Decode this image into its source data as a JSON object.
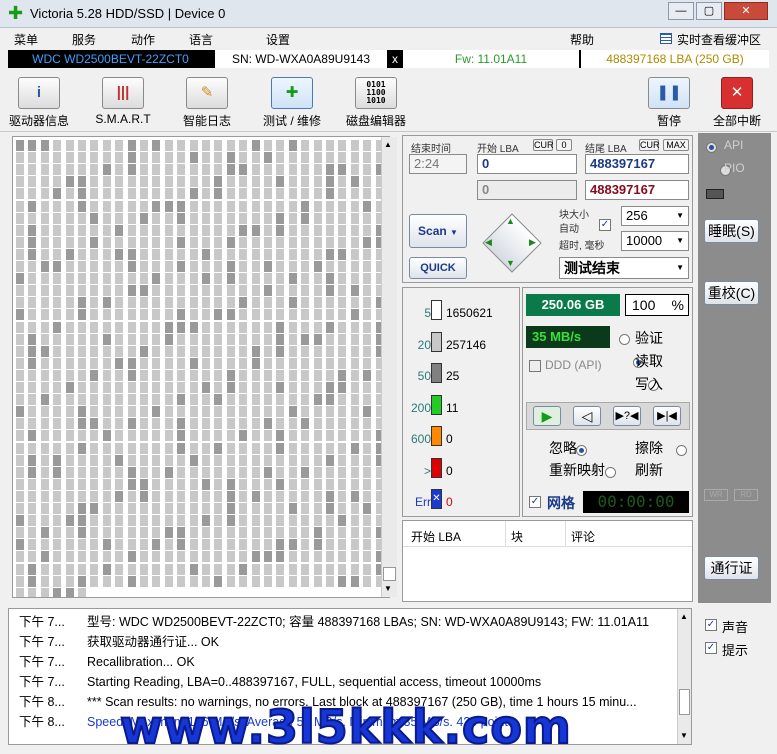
{
  "window": {
    "title": "Victoria 5.28 HDD/SSD | Device 0",
    "min": "—",
    "restore": "▢",
    "close": "✕"
  },
  "menu": {
    "items": [
      "菜单",
      "服务",
      "动作",
      "语言",
      "设置",
      "帮助"
    ],
    "realtime": "实时查看缓冲区"
  },
  "drive": {
    "model": "WDC WD2500BEVT-22ZCT0",
    "sn": "SN: WD-WXA0A89U9143",
    "x": "x",
    "fw": "Fw: 11.01A11",
    "lba": "488397168 LBA (250 GB)"
  },
  "toolbar": {
    "drive_info": "驱动器信息",
    "smart": "S.M.A.R.T",
    "smart_log": "智能日志",
    "test": "测试 / 维修",
    "disk_editor": "磁盘编辑器",
    "pause": "暂停",
    "abort": "全部中断"
  },
  "test": {
    "end_time_label": "结束时间",
    "end_time": "2:24",
    "start_lba_label": "开始 LBA",
    "cur": "CUR",
    "zero": "0",
    "end_lba_label": "结尾 LBA",
    "max": "MAX",
    "start_lba": "0",
    "end_lba": "488397167",
    "start_lba2": "0",
    "end_lba2": "488397167",
    "scan": "Scan",
    "quick": "QUICK",
    "block_size_label": "块大小",
    "auto_label": "自动",
    "timeout_label": "超时, 毫秒",
    "block_size": "256",
    "timeout": "10000",
    "status": "测试结束"
  },
  "stats": {
    "rows": [
      {
        "label": "5",
        "count": "1650621",
        "color": "#ffffff"
      },
      {
        "label": "20",
        "count": "257146",
        "color": "#c8c8c8"
      },
      {
        "label": "50",
        "count": "25",
        "color": "#808080"
      },
      {
        "label": "200",
        "count": "11",
        "color": "#22cc22"
      },
      {
        "label": "600",
        "count": "0",
        "color": "#ff8800"
      },
      {
        "label": ">",
        "count": "0",
        "color": "#dd0000"
      },
      {
        "label": "Err",
        "count": "0",
        "color": "#1a3ad0"
      }
    ],
    "size": "250.06 GB",
    "percent": "100",
    "pct": "%",
    "speed": "35 MB/s",
    "ddd": "DDD (API)",
    "verify": "验证",
    "read": "读取",
    "write": "写入",
    "ignore": "忽略",
    "erase": "擦除",
    "remap": "重新映射",
    "refresh": "刷新",
    "grid": "网格",
    "timer": "00:00:00"
  },
  "table": {
    "headers": [
      "开始 LBA",
      "块",
      "评论"
    ]
  },
  "side": {
    "api": "API",
    "pio": "PIO",
    "sleep": "睡眠(S)",
    "recal": "重校(C)",
    "wr": "WR",
    "rd": "RD",
    "passport": "通行证"
  },
  "log": {
    "rows": [
      {
        "t": "下午 7...",
        "m": "型号: WDC WD2500BEVT-22ZCT0; 容量 488397168 LBAs; SN: WD-WXA0A89U9143; FW: 11.01A11",
        "c": "#000000"
      },
      {
        "t": "下午 7...",
        "m": "获取驱动器通行证... OK",
        "c": "#000000"
      },
      {
        "t": "下午 7...",
        "m": "Recallibration... OK",
        "c": "#000000"
      },
      {
        "t": "下午 7...",
        "m": "Starting Reading, LBA=0..488397167, FULL, sequential access, timeout 10000ms",
        "c": "#000000"
      },
      {
        "t": "下午 8...",
        "m": "*** Scan results: no warnings, no errors. Last block at 488397167 (250 GB), time 1 hours 15 minu...",
        "c": "#000000"
      },
      {
        "t": "下午 8...",
        "m": "Speed: Maximum 106 MB/s. Average 52 MB/s. Minimum 35 MB/s. 420 points.",
        "c": "#1a3ad0"
      }
    ],
    "sound": "声音",
    "hints": "提示"
  },
  "watermark": "www.3l5kkk.com"
}
